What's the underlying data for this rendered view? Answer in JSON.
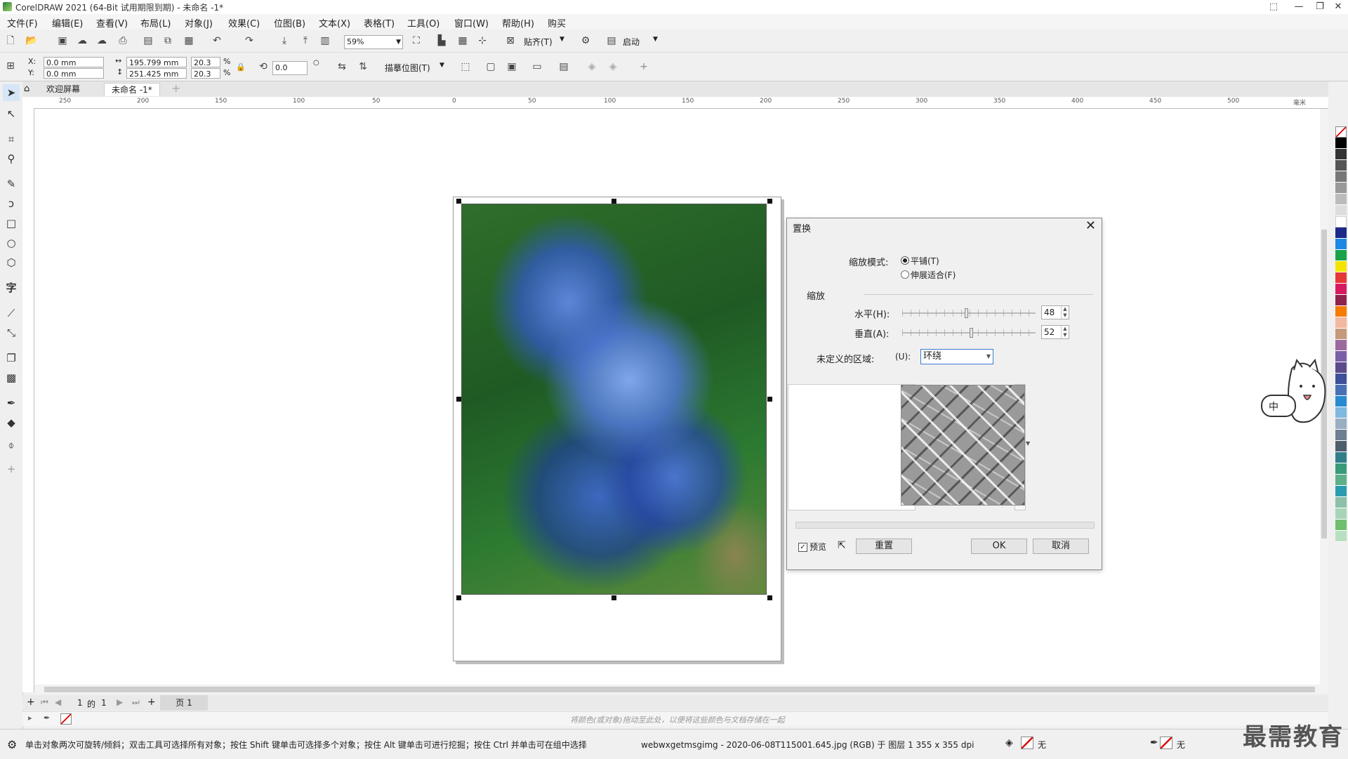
{
  "window": {
    "title": "CorelDRAW 2021 (64-Bit 试用期限到期) - 未命名 -1*"
  },
  "menu": [
    "文件(F)",
    "编辑(E)",
    "查看(V)",
    "布局(L)",
    "对象(J)",
    "效果(C)",
    "位图(B)",
    "文本(X)",
    "表格(T)",
    "工具(O)",
    "窗口(W)",
    "帮助(H)",
    "购买"
  ],
  "toolbar": {
    "zoom": "59%",
    "snap_label": "贴齐(T)",
    "launch_label": "启动"
  },
  "property_bar": {
    "x_label": "X:",
    "x_value": "0.0 mm",
    "y_label": "Y:",
    "y_value": "0.0 mm",
    "width": "195.799 mm",
    "height": "251.425 mm",
    "scale_w": "20.3",
    "scale_h": "20.3",
    "pct": "%",
    "rotation": "0.0",
    "trace_label": "描摹位图(T)"
  },
  "tabs": [
    "欢迎屏幕",
    "未命名 -1*"
  ],
  "ruler": {
    "h_ticks": [
      "250",
      "200",
      "150",
      "100",
      "50",
      "0",
      "50",
      "100",
      "150",
      "200",
      "250",
      "300",
      "350",
      "400",
      "450",
      "500"
    ],
    "unit": "毫米"
  },
  "page_nav": {
    "current": "1",
    "of": "的",
    "total": "1",
    "page_tab": "页 1"
  },
  "color_dock_hint": "将颜色(或对象)拖动至此处，以便将这些颜色与文档存储在一起",
  "status": {
    "hint": "单击对象两次可旋转/倾斜；双击工具可选择所有对象；按住 Shift 键单击可选择多个对象；按住 Alt 键单击可进行挖掘；按住 Ctrl 并单击可在组中选择",
    "object_info": "webwxgetmsgimg - 2020-06-08T115001.645.jpg (RGB) 于 图层 1 355 x 355 dpi",
    "fill_label": "无",
    "outline_label": "无"
  },
  "dialog": {
    "title": "置换",
    "scale_mode_label": "缩放模式:",
    "mode_tile": "平铺(T)",
    "mode_stretch": "伸展适合(F)",
    "scale_section": "缩放",
    "horizontal_label": "水平(H):",
    "horizontal_value": "48",
    "horizontal_fraction": 0.48,
    "vertical_label": "垂直(A):",
    "vertical_value": "52",
    "vertical_fraction": 0.52,
    "undefined_label": "未定义的区域:",
    "undefined_key": "(U):",
    "undefined_value": "环绕",
    "preview_label": "预览",
    "reset_label": "重置",
    "ok_label": "OK",
    "cancel_label": "取消"
  },
  "mascot_text": "中",
  "watermark": "最需教育",
  "colors": {
    "accent": "#2a7d3a",
    "selection": "#111111"
  }
}
